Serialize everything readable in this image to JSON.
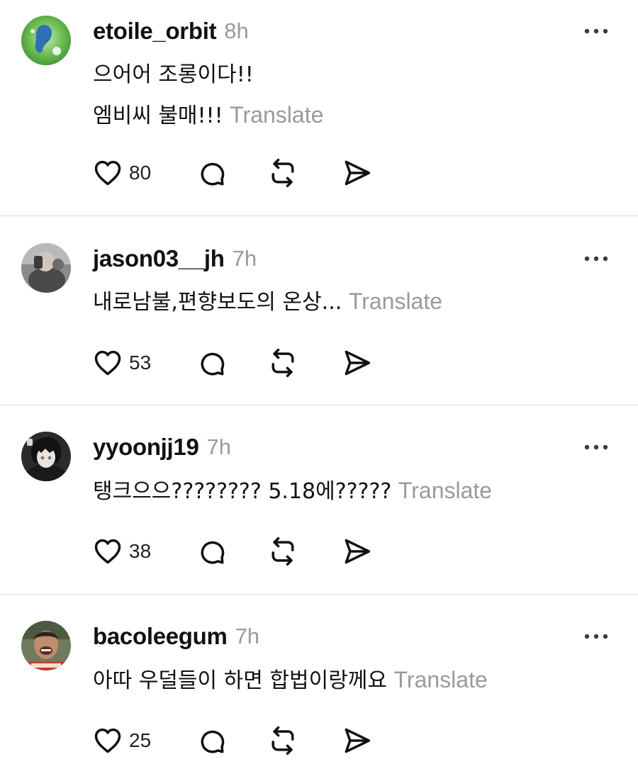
{
  "posts": [
    {
      "username": "etoile_orbit",
      "time": "8h",
      "lines": [
        "으어어 조롱이다!!",
        "엠비씨 불매!!!"
      ],
      "translate_label": "Translate",
      "likes": "80"
    },
    {
      "username": "jason03__jh",
      "time": "7h",
      "lines": [
        "내로남불,편향보도의 온상..."
      ],
      "translate_label": "Translate",
      "likes": "53"
    },
    {
      "username": "yyoonjj19",
      "time": "7h",
      "lines": [
        "탱크으으???????? 5.18에?????"
      ],
      "translate_label": "Translate",
      "likes": "38"
    },
    {
      "username": "bacoleegum",
      "time": "7h",
      "lines": [
        "아따 우덜들이 하면 합법이랑께요"
      ],
      "translate_label": "Translate",
      "likes": "25"
    }
  ],
  "icons": {
    "like": "heart-icon",
    "reply": "speech-bubble-icon",
    "repost": "repost-arrows-icon",
    "share": "paper-plane-icon",
    "more": "more-dots-icon"
  }
}
